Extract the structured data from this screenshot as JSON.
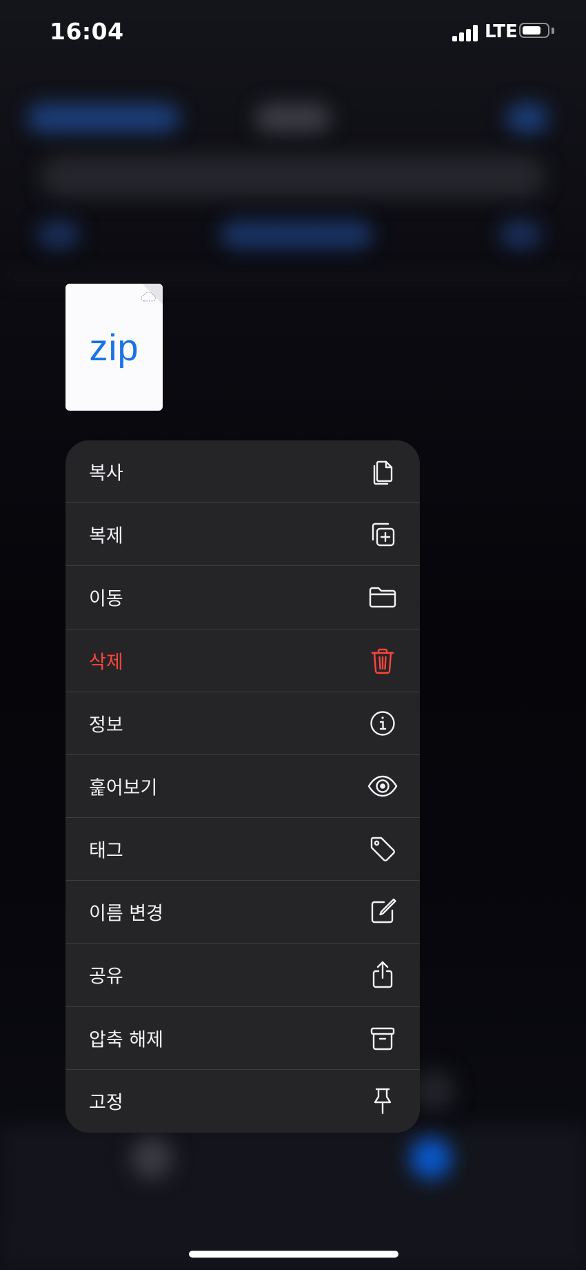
{
  "status_bar": {
    "time": "16:04",
    "network": "LTE",
    "signal_bars": 4,
    "battery_level": 0.8
  },
  "preview": {
    "file_extension": "zip"
  },
  "menu": {
    "items": [
      {
        "label": "복사",
        "icon": "copy-icon"
      },
      {
        "label": "복제",
        "icon": "duplicate-icon"
      },
      {
        "label": "이동",
        "icon": "folder-icon"
      },
      {
        "label": "삭제",
        "icon": "trash-icon",
        "destructive": true
      },
      {
        "label": "정보",
        "icon": "info-icon"
      },
      {
        "label": "훑어보기",
        "icon": "eye-icon"
      },
      {
        "label": "태그",
        "icon": "tag-icon"
      },
      {
        "label": "이름 변경",
        "icon": "rename-icon"
      },
      {
        "label": "공유",
        "icon": "share-icon"
      },
      {
        "label": "압축 해제",
        "icon": "archive-icon"
      },
      {
        "label": "고정",
        "icon": "pin-icon"
      }
    ]
  },
  "colors": {
    "accent": "#1a73e8",
    "destructive": "#ff453a",
    "menu_background": "#252528",
    "separator": "#3d3d41"
  }
}
